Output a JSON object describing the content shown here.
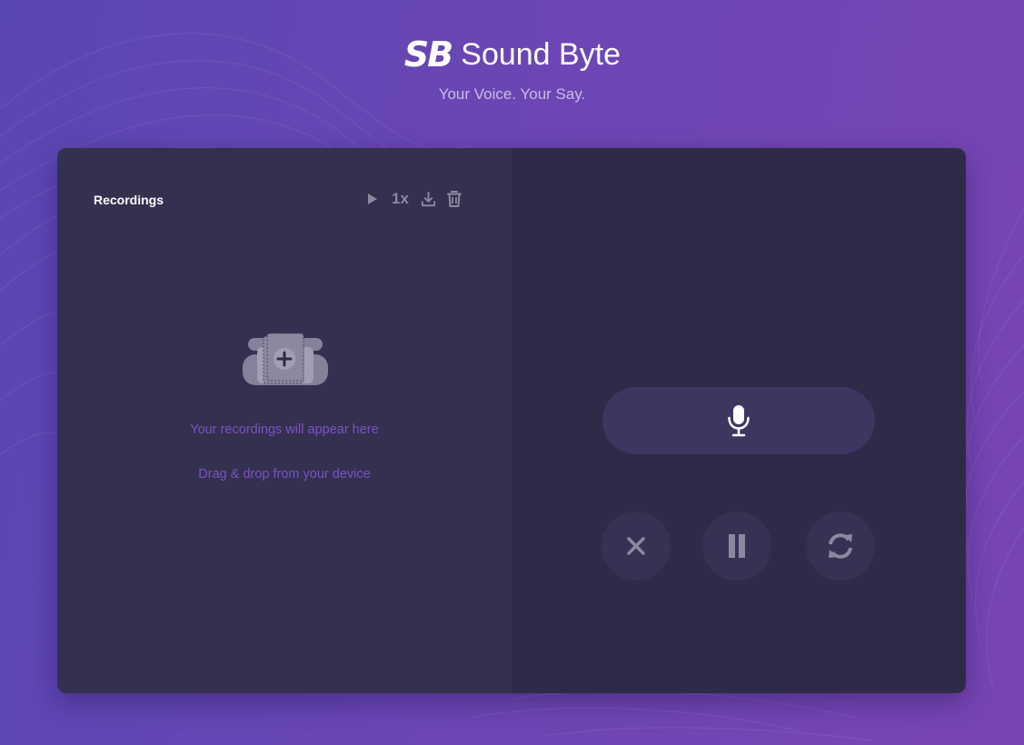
{
  "brand": {
    "logo": "SB",
    "name": "Sound Byte",
    "tagline": "Your Voice. Your Say."
  },
  "recordings_panel": {
    "title": "Recordings",
    "speed_label": "1x",
    "icons": [
      "play-icon",
      "download-icon",
      "trash-icon"
    ],
    "empty_icon": "empty-recordings-illustration",
    "empty_message": "Your recordings will appear here",
    "drop_hint": "Drag & drop from your device"
  },
  "recorder_panel": {
    "record_icon": "microphone-icon",
    "controls": [
      "close-icon",
      "pause-icon",
      "refresh-icon"
    ]
  },
  "colors": {
    "background_start": "#5a46b4",
    "background_end": "#7845b3",
    "left_panel": "#34304f",
    "right_panel": "#2e2b48",
    "accent_text": "#7a52c6",
    "icon_muted": "#8d889f"
  }
}
